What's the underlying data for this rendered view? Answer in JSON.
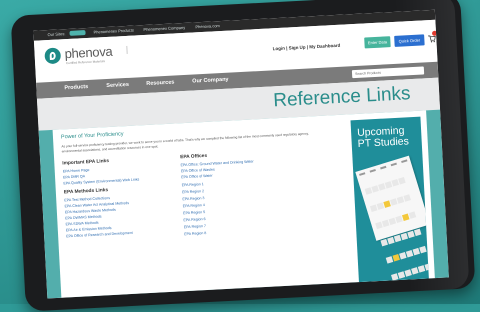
{
  "topbar": {
    "left_text": "Our Sites:",
    "links": [
      "Phenomenex Products",
      "Phenomenex Company",
      "Phenova.com"
    ]
  },
  "header": {
    "logo": "phenova",
    "tagline": "Certified Reference Materials",
    "links": "Login | Sign Up | My Dashboard",
    "green_button": "Enter Data",
    "blue_button": "Quick Order"
  },
  "nav": {
    "items": [
      "Products",
      "Services",
      "Resources",
      "Our Company"
    ],
    "search_placeholder": "Search Products"
  },
  "banner": {
    "title": "Reference Links"
  },
  "main": {
    "heading": "Power of Your Proficiency",
    "intro": "As your full-service proficiency testing provider, we work to serve you in a world of labs. That's why we compiled the following list of the most commonly used regulatory agency, environmental associations, and accreditation resources in one spot.",
    "left_col": {
      "heading1": "Important EPA Links",
      "links1": [
        "EPA Home Page",
        "EPA DMR QA",
        "EPA Quality System (Environmental) Web Links"
      ],
      "heading2": "EPA Methods Links",
      "links2": [
        "EPA Test Method Collections",
        "EPA Clean Water Act Analytical Methods",
        "EPA Hazardous Waste Methods",
        "EPA DWMAS Methods",
        "EPA SDWA Methods",
        "EPA Air & Emission Methods",
        "EPA Office of Research and Development"
      ]
    },
    "right_col": {
      "heading1": "EPA Offices",
      "links1": [
        "EPA Office: Ground Water and Drinking Water",
        "EPA Office of Wastes",
        "EPA Office of Water",
        "EPA Region 1",
        "EPA Region 2",
        "EPA Region 3",
        "EPA Region 4",
        "EPA Region 5",
        "EPA Region 6",
        "EPA Region 7",
        "EPA Region 8"
      ]
    }
  },
  "sidebar": {
    "title": "Upcoming PT Studies"
  },
  "colors": {
    "teal": "#2a8d8b",
    "green_btn": "#46b49c",
    "blue_btn": "#2b6fd0",
    "nav": "#7b7b7b"
  }
}
